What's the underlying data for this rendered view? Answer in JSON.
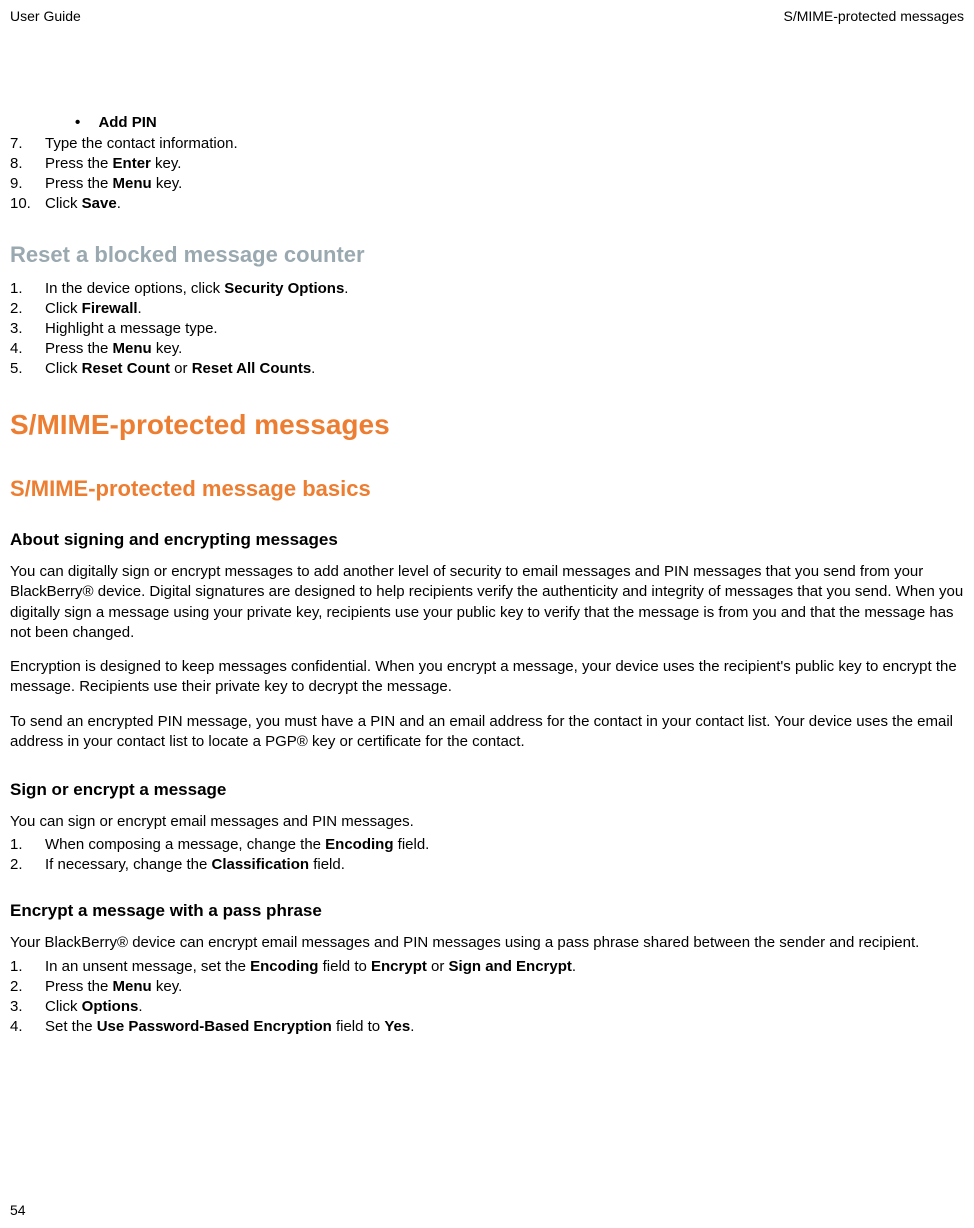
{
  "header": {
    "left": "User Guide",
    "right": "S/MIME-protected messages"
  },
  "bullet": {
    "label": "Add PIN"
  },
  "steps_top": [
    {
      "num": "7.",
      "text_parts": [
        "Type the contact information."
      ]
    },
    {
      "num": "8.",
      "text_parts": [
        "Press the ",
        "Enter",
        " key."
      ]
    },
    {
      "num": "9.",
      "text_parts": [
        "Press the ",
        "Menu",
        " key."
      ]
    },
    {
      "num": "10.",
      "text_parts": [
        "Click ",
        "Save",
        "."
      ]
    }
  ],
  "section_reset": {
    "title": "Reset a blocked message counter",
    "steps": [
      {
        "num": "1.",
        "text_parts": [
          "In the device options, click ",
          "Security Options",
          "."
        ]
      },
      {
        "num": "2.",
        "text_parts": [
          "Click ",
          "Firewall",
          "."
        ]
      },
      {
        "num": "3.",
        "text_parts": [
          "Highlight a message type."
        ]
      },
      {
        "num": "4.",
        "text_parts": [
          "Press the ",
          "Menu",
          " key."
        ]
      },
      {
        "num": "5.",
        "text_parts": [
          "Click ",
          "Reset Count",
          " or ",
          "Reset All Counts",
          "."
        ]
      }
    ]
  },
  "section_smime": {
    "title": "S/MIME-protected messages"
  },
  "section_basics": {
    "title": "S/MIME-protected message basics"
  },
  "section_about": {
    "title": "About signing and encrypting messages",
    "p1": "You can digitally sign or encrypt messages to add another level of security to email messages and PIN messages that you send from your BlackBerry® device. Digital signatures are designed to help recipients verify the authenticity and integrity of messages that you send. When you digitally sign a message using your private key, recipients use your public key to verify that the message is from you and that the message has not been changed.",
    "p2": "Encryption is designed to keep messages confidential. When you encrypt a message, your device uses the recipient's public key to encrypt the message. Recipients use their private key to decrypt the message.",
    "p3": "To send an encrypted PIN message, you must have a PIN and an email address for the contact in your contact list. Your device uses the email address in your contact list to locate a PGP® key or certificate for the contact."
  },
  "section_sign": {
    "title": "Sign or encrypt a message",
    "intro": "You can sign or encrypt email messages and PIN messages.",
    "steps": [
      {
        "num": "1.",
        "text_parts": [
          "When composing a message, change the ",
          "Encoding",
          " field."
        ]
      },
      {
        "num": "2.",
        "text_parts": [
          "If necessary, change the ",
          "Classification",
          " field."
        ]
      }
    ]
  },
  "section_encrypt": {
    "title": "Encrypt a message with a pass phrase",
    "intro": "Your BlackBerry® device can encrypt email messages and PIN messages using a pass phrase shared between the sender and recipient.",
    "steps": [
      {
        "num": "1.",
        "text_parts": [
          "In an unsent message, set the ",
          "Encoding",
          " field to ",
          "Encrypt",
          " or ",
          "Sign and Encrypt",
          "."
        ]
      },
      {
        "num": "2.",
        "text_parts": [
          "Press the ",
          "Menu",
          " key."
        ]
      },
      {
        "num": "3.",
        "text_parts": [
          "Click ",
          "Options",
          "."
        ]
      },
      {
        "num": "4.",
        "text_parts": [
          "Set the ",
          "Use Password-Based Encryption",
          " field to ",
          "Yes",
          "."
        ]
      }
    ]
  },
  "page_number": "54"
}
